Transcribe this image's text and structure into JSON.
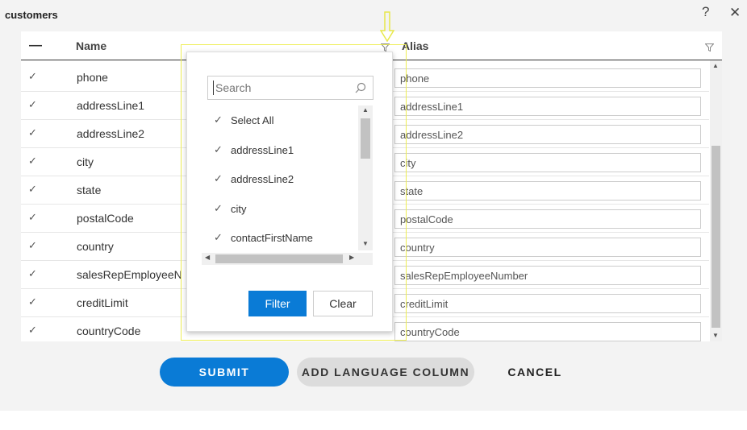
{
  "dialog": {
    "title": "customers",
    "help_icon": "question-icon",
    "close_icon": "close-icon"
  },
  "grid": {
    "columns": {
      "select": "—",
      "name": "Name",
      "alias": "Alias"
    },
    "rows": [
      {
        "name": "phone",
        "alias": "phone"
      },
      {
        "name": "addressLine1",
        "alias": "addressLine1"
      },
      {
        "name": "addressLine2",
        "alias": "addressLine2"
      },
      {
        "name": "city",
        "alias": "city"
      },
      {
        "name": "state",
        "alias": "state"
      },
      {
        "name": "postalCode",
        "alias": "postalCode"
      },
      {
        "name": "country",
        "alias": "country"
      },
      {
        "name": "salesRepEmployeeNumber",
        "alias": "salesRepEmployeeNumber"
      },
      {
        "name": "creditLimit",
        "alias": "creditLimit"
      },
      {
        "name": "countryCode",
        "alias": "countryCode"
      }
    ]
  },
  "filter_popup": {
    "search_placeholder": "Search",
    "items": [
      {
        "label": "Select All"
      },
      {
        "label": "addressLine1"
      },
      {
        "label": "addressLine2"
      },
      {
        "label": "city"
      },
      {
        "label": "contactFirstName"
      }
    ],
    "filter_label": "Filter",
    "clear_label": "Clear"
  },
  "footer": {
    "submit_label": "SUBMIT",
    "add_language_label": "ADD LANGUAGE COLUMN",
    "cancel_label": "CANCEL"
  },
  "colors": {
    "accent": "#0a7bd6",
    "highlight": "#eeee55"
  }
}
